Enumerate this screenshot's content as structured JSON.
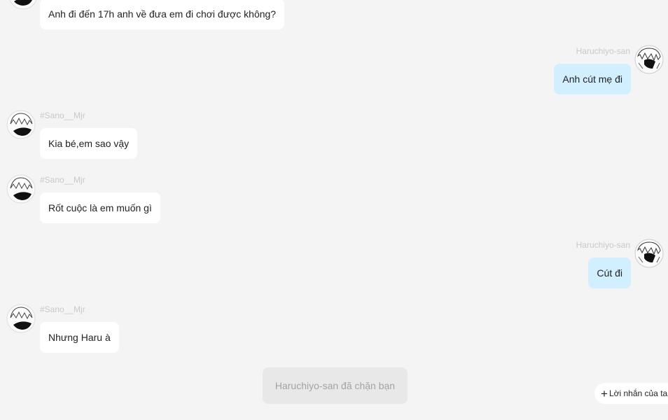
{
  "messages": [
    {
      "side": "left",
      "sender": "",
      "text": "Anh đi đến 17h anh về đưa em đi chơi được không?"
    },
    {
      "side": "right",
      "sender": "Haruchiyo-san",
      "text": "Anh cút mẹ đi"
    },
    {
      "side": "left",
      "sender": "#Sano__Mjr",
      "text": "Kia bé,em sao vậy"
    },
    {
      "side": "left",
      "sender": "#Sano__Mjr",
      "text": "Rốt cuộc là em muốn gì"
    },
    {
      "side": "right",
      "sender": "Haruchiyo-san",
      "text": "Cút đi"
    },
    {
      "side": "left",
      "sender": "#Sano__Mjr",
      "text": "Nhưng Haru à"
    }
  ],
  "system_message": "Haruchiyo-san đã chặn bạn",
  "note_button": {
    "icon": "plus-icon",
    "label": "Lời nhắn của ta"
  },
  "colors": {
    "background": "#f4f4f4",
    "bubble_left": "#ffffff",
    "bubble_right": "#d1efff",
    "sender_text": "#c9c9c9"
  }
}
